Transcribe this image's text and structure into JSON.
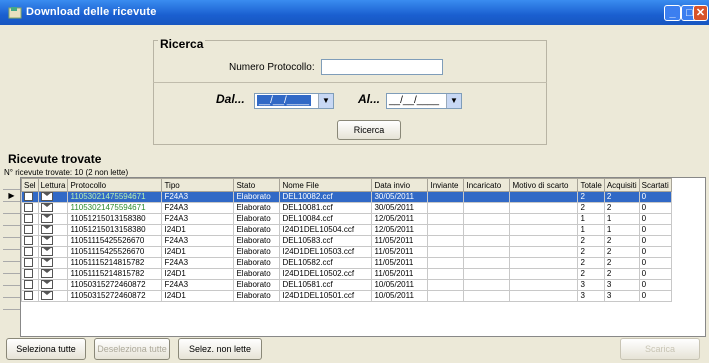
{
  "window": {
    "title": "Download delle ricevute"
  },
  "search": {
    "group_title": "Ricerca",
    "protocol_label": "Numero Protocollo:",
    "protocol_value": "",
    "from_label": "Dal...",
    "from_value": "__/__/____",
    "to_label": "Al...",
    "to_value": "__/__/____",
    "search_button": "Ricerca"
  },
  "results": {
    "title": "Ricevute trovate",
    "count_text": "N° ricevute trovate: 10 (2 non lette)",
    "columns": [
      "Sel",
      "Lettura",
      "Protocollo",
      "Tipo",
      "Stato",
      "Nome File",
      "Data invio",
      "Inviante",
      "Incaricato",
      "Motivo di scarto",
      "Totale",
      "Acquisiti",
      "Scartati"
    ],
    "rows": [
      {
        "protocollo": "11053021475594671",
        "tipo": "F24A3",
        "stato": "Elaborato",
        "file": "DEL10082.ccf",
        "data": "30/05/2011",
        "totale": "2",
        "acquisiti": "2",
        "scartati": "0",
        "lettura": "read"
      },
      {
        "protocollo": "11053021475594671",
        "tipo": "F24A3",
        "stato": "Elaborato",
        "file": "DEL10081.ccf",
        "data": "30/05/2011",
        "totale": "2",
        "acquisiti": "2",
        "scartati": "0",
        "lettura": "read"
      },
      {
        "protocollo": "11051215013158380",
        "tipo": "F24A3",
        "stato": "Elaborato",
        "file": "DEL10084.ccf",
        "data": "12/05/2011",
        "totale": "1",
        "acquisiti": "1",
        "scartati": "0",
        "lettura": "open"
      },
      {
        "protocollo": "11051215013158380",
        "tipo": "I24D1",
        "stato": "Elaborato",
        "file": "I24D1DEL10504.ccf",
        "data": "12/05/2011",
        "totale": "1",
        "acquisiti": "1",
        "scartati": "0",
        "lettura": "open"
      },
      {
        "protocollo": "11051115425526670",
        "tipo": "F24A3",
        "stato": "Elaborato",
        "file": "DEL10583.ccf",
        "data": "11/05/2011",
        "totale": "2",
        "acquisiti": "2",
        "scartati": "0",
        "lettura": "open"
      },
      {
        "protocollo": "11051115425526670",
        "tipo": "I24D1",
        "stato": "Elaborato",
        "file": "I24D1DEL10503.ccf",
        "data": "11/05/2011",
        "totale": "2",
        "acquisiti": "2",
        "scartati": "0",
        "lettura": "open"
      },
      {
        "protocollo": "11051115214815782",
        "tipo": "F24A3",
        "stato": "Elaborato",
        "file": "DEL10582.ccf",
        "data": "11/05/2011",
        "totale": "2",
        "acquisiti": "2",
        "scartati": "0",
        "lettura": "open"
      },
      {
        "protocollo": "11051115214815782",
        "tipo": "I24D1",
        "stato": "Elaborato",
        "file": "I24D1DEL10502.ccf",
        "data": "11/05/2011",
        "totale": "2",
        "acquisiti": "2",
        "scartati": "0",
        "lettura": "open"
      },
      {
        "protocollo": "11050315272460872",
        "tipo": "F24A3",
        "stato": "Elaborato",
        "file": "DEL10581.ccf",
        "data": "10/05/2011",
        "totale": "3",
        "acquisiti": "3",
        "scartati": "0",
        "lettura": "open"
      },
      {
        "protocollo": "11050315272460872",
        "tipo": "I24D1",
        "stato": "Elaborato",
        "file": "I24D1DEL10501.ccf",
        "data": "10/05/2011",
        "totale": "3",
        "acquisiti": "3",
        "scartati": "0",
        "lettura": "open"
      }
    ]
  },
  "footer": {
    "select_all": "Seleziona tutte",
    "deselect_all": "Deseleziona tutte",
    "select_unread": "Selez. non lette",
    "download": "Scarica"
  }
}
